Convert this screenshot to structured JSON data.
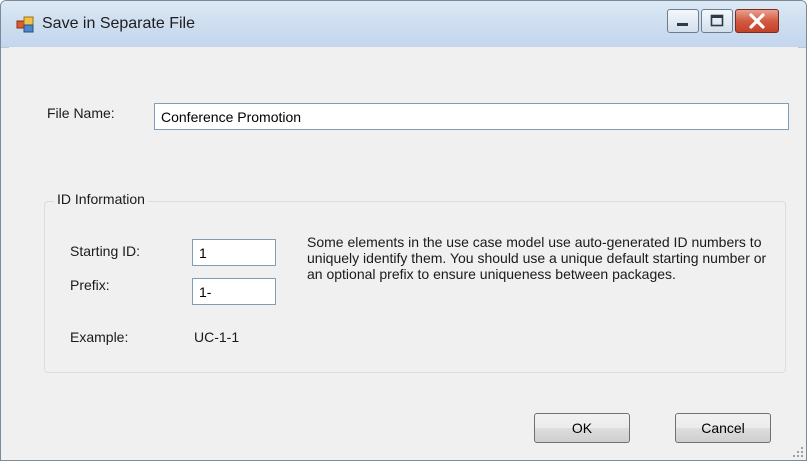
{
  "window": {
    "title": "Save in Separate File",
    "icons": {
      "app": "window-app-icon",
      "minimize": "minimize-icon",
      "maximize": "maximize-icon",
      "close": "close-icon"
    },
    "colors": {
      "titlebar": "#cfdff0",
      "close_button": "#d35a40",
      "client": "#f0f0f0"
    }
  },
  "file_name": {
    "label": "File Name:",
    "value": "Conference Promotion"
  },
  "id_information": {
    "caption": "ID Information",
    "starting_id_label": "Starting ID:",
    "starting_id_value": "1",
    "prefix_label": "Prefix:",
    "prefix_value": "1-",
    "example_label": "Example:",
    "example_value": "UC-1-1",
    "description": "Some elements in the use case model use auto-generated ID numbers to uniquely identify them. You should use a unique default starting number or an optional prefix to ensure uniqueness between packages."
  },
  "buttons": {
    "ok": "OK",
    "cancel": "Cancel"
  }
}
